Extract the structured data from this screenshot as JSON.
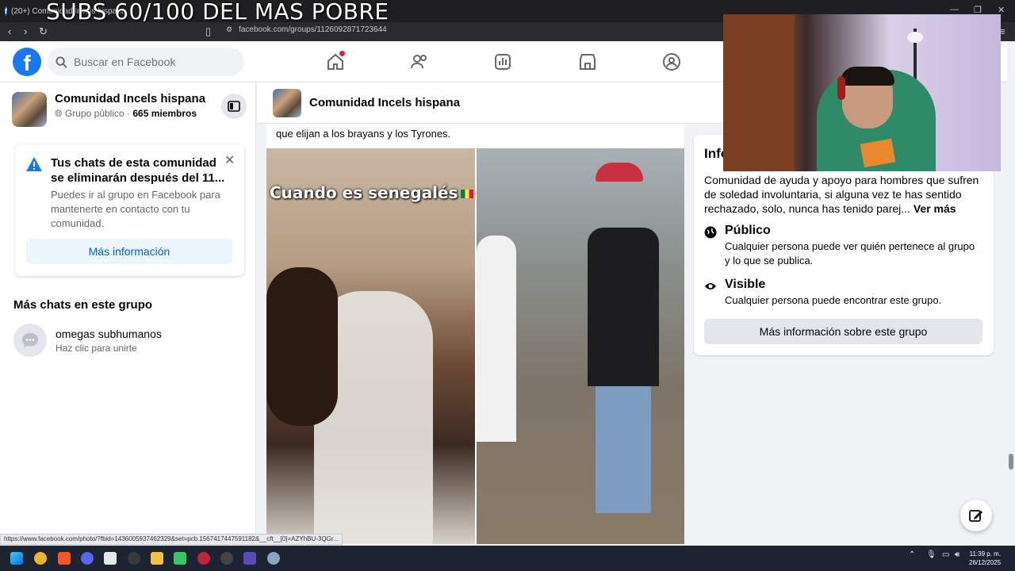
{
  "browser": {
    "tab_title": "(20+) Comunidad Incels hispana",
    "overlay_title": "SUBS 60/100 DEL MAS POBRE",
    "url": "facebook.com/groups/1126092871723644",
    "status_url": "https://www.facebook.com/photo/?fbid=1436005937462329&set=pcb.1567417447591182&__cft__[0]=AZYhBU-3QGr..."
  },
  "header": {
    "logo": "f",
    "search_placeholder": "Buscar en Facebook"
  },
  "sidebar": {
    "group_name": "Comunidad Incels hispana",
    "group_type": "Grupo público · ",
    "members": "665 miembros",
    "notice_title": "Tus chats de esta comunidad se eliminarán después del 11...",
    "notice_body": "Puedes ir al grupo en Facebook para mantenerte en contacto con tu comunidad.",
    "notice_button": "Más información",
    "more_chats_heading": "Más chats en este grupo",
    "chat_name": "omegas subhumanos",
    "chat_sub": "Haz clic para unirte"
  },
  "feed": {
    "group_title": "Comunidad Incels hispana",
    "post_text": "que elijan a los brayans y los Tyrones.",
    "photo_caption": "Cuando es senegalés"
  },
  "info": {
    "title": "Info",
    "description": "Comunidad de ayuda y apoyo para hombres que sufren de soledad involuntaria, si alguna vez te has sentido rechazado, solo, nunca has tenido parej...",
    "see_more": "Ver más",
    "public_title": "Público",
    "public_desc": "Cualquier persona puede ver quién pertenece al grupo y lo que se publica.",
    "visible_title": "Visible",
    "visible_desc": "Cualquier persona puede encontrar este grupo.",
    "more_button": "Más información sobre este grupo"
  },
  "taskbar": {
    "time": "11:39 p. m.",
    "date": "26/12/2025"
  }
}
